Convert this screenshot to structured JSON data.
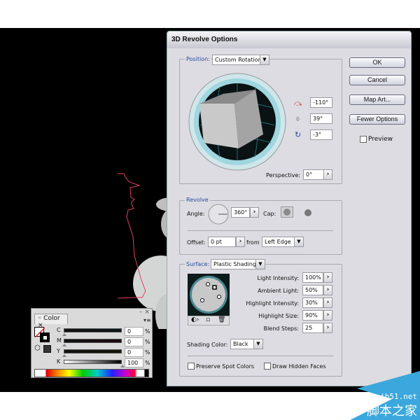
{
  "dialog": {
    "title": "3D Revolve Options",
    "position": {
      "label": "Position:",
      "value": "Custom Rotation",
      "rotation_x": "-110°",
      "rotation_y": "39°",
      "rotation_z": "-3°",
      "perspective_label": "Perspective:",
      "perspective_value": "0°"
    },
    "buttons": {
      "ok": "OK",
      "cancel": "Cancel",
      "map_art": "Map Art...",
      "fewer_options": "Fewer Options"
    },
    "preview": {
      "label": "Preview",
      "checked": false
    },
    "revolve": {
      "label": "Revolve",
      "angle_label": "Angle:",
      "angle_value": "360°",
      "cap_label": "Cap:",
      "offset_label": "Offset:",
      "offset_value": "0 pt",
      "from_label": "from",
      "from_value": "Left Edge"
    },
    "surface": {
      "label": "Surface:",
      "value": "Plastic Shading",
      "rows": [
        {
          "label": "Light Intensity:",
          "value": "100%"
        },
        {
          "label": "Ambient Light:",
          "value": "50%"
        },
        {
          "label": "Highlight Intensity:",
          "value": "30%"
        },
        {
          "label": "Highlight Size:",
          "value": "90%"
        },
        {
          "label": "Blend Steps:",
          "value": "25"
        }
      ],
      "shading_color_label": "Shading Color:",
      "shading_color_value": "Black",
      "preserve_spot_colors": "Preserve Spot Colors",
      "draw_hidden_faces": "Draw Hidden Faces"
    }
  },
  "color_panel": {
    "tab": "Color",
    "channels": [
      {
        "label": "C",
        "value": "0",
        "unit": "%"
      },
      {
        "label": "M",
        "value": "0",
        "unit": "%"
      },
      {
        "label": "Y",
        "value": "0",
        "unit": "%"
      },
      {
        "label": "K",
        "value": "100",
        "unit": "%"
      }
    ]
  },
  "watermark": {
    "site": "jb51.net",
    "name": "脚本之家",
    "color": "#3aa8dc"
  },
  "colors": {
    "path": "#e04060",
    "accent": "#2a4aa0"
  }
}
